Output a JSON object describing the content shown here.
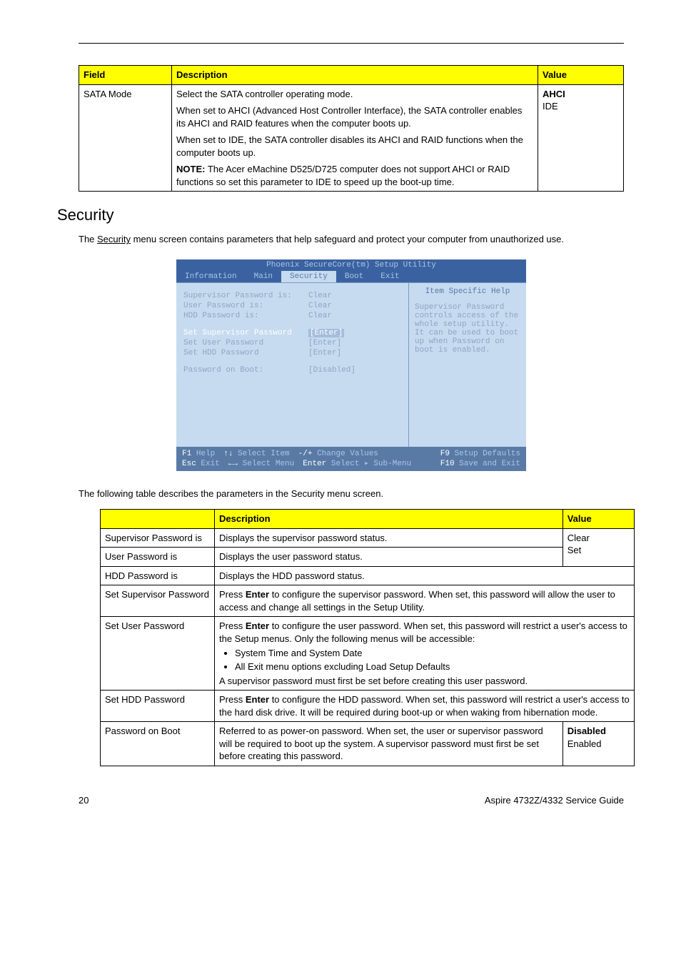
{
  "top_table": {
    "headers": {
      "field": "Field",
      "description": "Description",
      "value": "Value"
    },
    "row": {
      "field": "SATA Mode",
      "desc_p1": "Select the SATA controller operating mode.",
      "desc_p2": "When set to AHCI (Advanced Host Controller Interface), the SATA controller enables its AHCI and RAID features when the computer boots up.",
      "desc_p3": "When set to IDE, the SATA controller disables its AHCI and RAID functions when the computer boots up.",
      "note_label": "NOTE:",
      "note_text": " The Acer eMachine D525/D725 computer does not support AHCI or RAID functions so set this parameter to IDE to speed up the boot-up time.",
      "val1": "AHCI",
      "val2": "IDE"
    }
  },
  "security_heading": "Security",
  "security_intro_pre": "The ",
  "security_intro_link": "Security",
  "security_intro_post": " menu screen contains parameters that help safeguard and protect your computer from unauthorized use.",
  "bios": {
    "title": "Phoenix SecureCore(tm) Setup Utility",
    "tabs": {
      "info": "Information",
      "main": "Main",
      "security": "Security",
      "boot": "Boot",
      "exit": "Exit"
    },
    "rows": {
      "sup_lbl": "Supervisor Password is:",
      "sup_val": "Clear",
      "usr_lbl": "User Password is:",
      "usr_val": "Clear",
      "hdd_lbl": "HDD Password is:",
      "hdd_val": "Clear",
      "setsup_lbl": "Set Supervisor Password",
      "setsup_val": "[Enter]",
      "setusr_lbl": "Set User Password",
      "setusr_val": "[Enter]",
      "sethdd_lbl": "Set HDD Password",
      "sethdd_val": "[Enter]",
      "pob_lbl": "Password on Boot:",
      "pob_val": "[Disabled]"
    },
    "help_title": "Item Specific Help",
    "help_text": "Supervisor Password controls access of the whole setup utility. It can be used to boot up when Password on boot is enabled.",
    "footer": {
      "f1": "F1",
      "help": "Help",
      "arrows_v": "↑↓",
      "select_item": "Select Item",
      "pm": "-/+",
      "change": "Change Values",
      "f9": "F9",
      "defaults": "Setup Defaults",
      "esc": "Esc",
      "exit": "Exit",
      "arrows_h": "←→",
      "select_menu": "Select Menu",
      "enter": "Enter",
      "select": "Select",
      "submenu": "▸ Sub-Menu",
      "f10": "F10",
      "save": "Save and Exit"
    }
  },
  "table_intro": "The following table describes the parameters in the Security menu screen.",
  "params_table": {
    "headers": {
      "blank": "",
      "desc": "Description",
      "value": "Value"
    },
    "r1": {
      "c1": "Supervisor Password is",
      "c2": "Displays the supervisor password status.",
      "c3": "Clear"
    },
    "r2": {
      "c1": "User Password is",
      "c2": "Displays the user password status.",
      "c3": "Set"
    },
    "r3": {
      "c1": "HDD Password is",
      "c2": "Displays the HDD password status."
    },
    "r4": {
      "c1": "Set Supervisor Password",
      "pre": "Press ",
      "enter": "Enter",
      "post": " to configure the supervisor password. When set, this password will allow the user to access and change all settings in the Setup Utility."
    },
    "r5": {
      "c1": "Set User Password",
      "pre": "Press ",
      "enter": "Enter",
      "post": " to configure the user password. When set, this password will restrict a user's access to the Setup menus. Only the following menus will be accessible:",
      "b1": "System Time and System Date",
      "b2": "All Exit menu options excluding Load Setup Defaults",
      "tail": "A supervisor password must first be set before creating this user password."
    },
    "r6": {
      "c1": "Set HDD Password",
      "pre": "Press ",
      "enter": "Enter",
      "post": " to configure the HDD password. When set, this password will restrict a user's access to the hard disk drive. It will be required during boot-up or when waking from hibernation mode."
    },
    "r7": {
      "c1": "Password on Boot",
      "c2": "Referred to as power-on password. When set, the user or supervisor password will be required to boot up the system. A supervisor password must first be set before creating this password.",
      "c3a": "Disabled",
      "c3b": "Enabled"
    }
  },
  "footer": {
    "page": "20",
    "guide": "Aspire 4732Z/4332 Service Guide"
  }
}
